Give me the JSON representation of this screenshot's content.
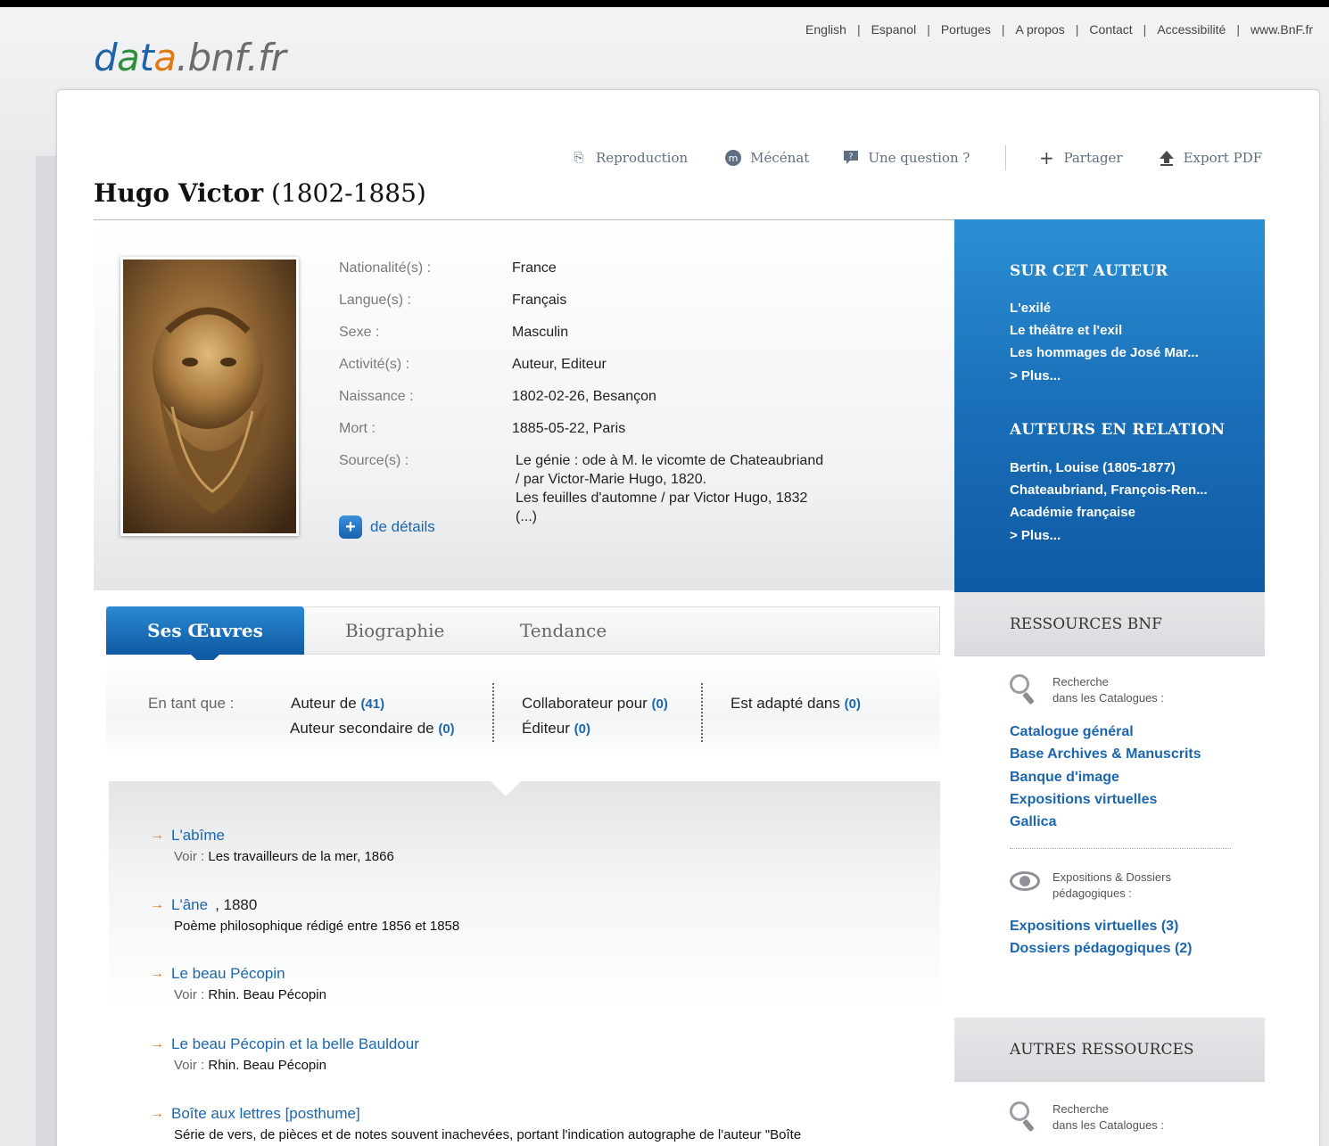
{
  "site": {
    "logo_parts": [
      "d",
      "a",
      "t",
      "a",
      ".bnf.fr"
    ],
    "top_links": [
      "English",
      "Espanol",
      "Portuges",
      "A propos",
      "Contact",
      "Accessibilité",
      "www.BnF.fr"
    ]
  },
  "actions": {
    "reproduction": "Reproduction",
    "mecenat": "Mécénat",
    "question": "Une question ?",
    "partager": "Partager",
    "export": "Export PDF"
  },
  "author": {
    "name": "Hugo Victor",
    "dates": "(1802-1885)"
  },
  "facts": [
    {
      "label": "Nationalité(s) :",
      "value": "France"
    },
    {
      "label": "Langue(s) :",
      "value": "Français"
    },
    {
      "label": "Sexe :",
      "value": "Masculin"
    },
    {
      "label": "Activité(s) :",
      "value": "Auteur, Editeur"
    },
    {
      "label": "Naissance :",
      "value": "1802-02-26, Besançon"
    },
    {
      "label": "Mort :",
      "value": "1885-05-22, Paris"
    },
    {
      "label": "Source(s) :",
      "value": ""
    }
  ],
  "sources": [
    "Le génie : ode à M. le vicomte de Chateaubriand",
    "/ par Victor-Marie Hugo, 1820.",
    "Les feuilles d'automne / par Victor Hugo, 1832",
    "(...)"
  ],
  "details_link": "de détails",
  "sidebar": {
    "about_title": "SUR CET AUTEUR",
    "about_links": [
      "L'exilé",
      "Le théâtre et l'exil",
      "Les hommages de José Mar...",
      "> Plus..."
    ],
    "related_title": "AUTEURS EN RELATION",
    "related_links": [
      "Bertin, Louise (1805-1877)",
      "Chateaubriand, François-Ren...",
      "Académie française",
      "> Plus..."
    ],
    "bnf_title": "RESSOURCES BNF",
    "search_label_1": "Recherche",
    "search_label_2": "dans les Catalogues :",
    "bnf_links": [
      "Catalogue général",
      "Base Archives & Manuscrits",
      "Banque d'image",
      "Expositions virtuelles",
      "Gallica"
    ],
    "expo_label_1": "Expositions & Dossiers",
    "expo_label_2": "pédagogiques :",
    "expo_links": [
      "Expositions virtuelles (3)",
      "Dossiers pédagogiques (2)"
    ],
    "other_title": "AUTRES RESSOURCES",
    "other_search_1": "Recherche",
    "other_search_2": "dans les Catalogues :"
  },
  "tabs": [
    "Ses Œuvres",
    "Biographie",
    "Tendance"
  ],
  "roles": {
    "label": "En tant que :",
    "items": [
      {
        "text": "Auteur de",
        "count": "(41)"
      },
      {
        "text": "Auteur secondaire de",
        "count": "(0)"
      },
      {
        "text": "Collaborateur pour",
        "count": "(0)"
      },
      {
        "text": "Éditeur",
        "count": "(0)"
      },
      {
        "text": "Est adapté dans",
        "count": "(0)"
      }
    ]
  },
  "works": [
    {
      "title": "L'abîme",
      "year": "",
      "voir": "Voir :",
      "desc": "Les travailleurs de la mer, 1866"
    },
    {
      "title": "L'âne",
      "year": ", 1880",
      "voir": "",
      "desc": "Poème philosophique rédigé entre 1856 et 1858"
    },
    {
      "title": "Le beau Pécopin",
      "year": "",
      "voir": "Voir :",
      "desc": "Rhin. Beau Pécopin"
    },
    {
      "title": "Le beau Pécopin et la belle Bauldour",
      "year": "",
      "voir": "Voir :",
      "desc": "Rhin. Beau Pécopin"
    },
    {
      "title": "Boîte aux lettres [posthume]",
      "year": "",
      "voir": "",
      "desc": "Série de vers, de pièces et de notes souvent inachevées, portant l'indication autographe de l'auteur \"Boîte"
    }
  ]
}
